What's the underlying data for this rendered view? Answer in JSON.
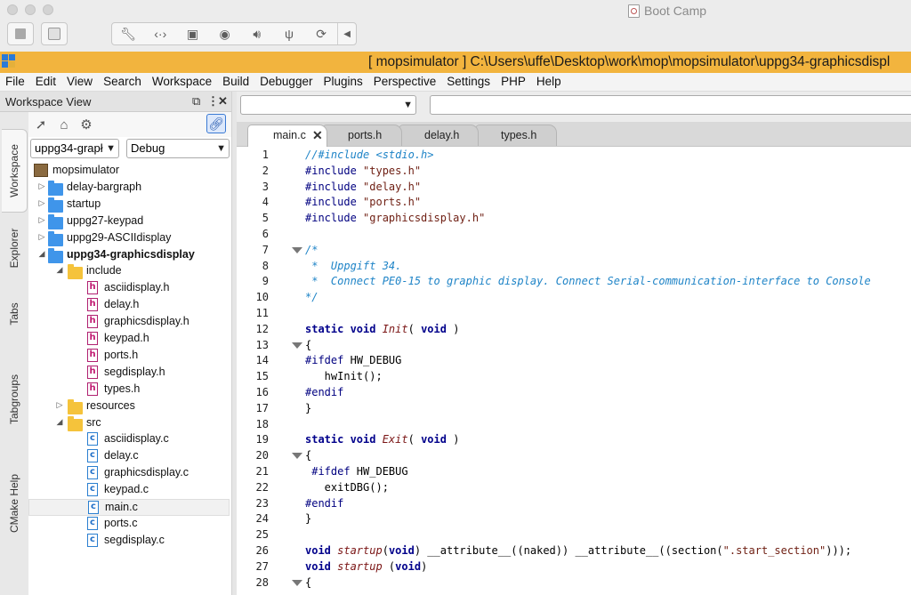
{
  "vm": {
    "title": "Boot Camp",
    "toolbar_icons": [
      "wrench-icon",
      "arrows-icon",
      "hdd-icon",
      "camera-icon",
      "speaker-icon",
      "usb-icon",
      "refresh-icon"
    ]
  },
  "window": {
    "title": "[ mopsimulator ] C:\\Users\\uffe\\Desktop\\work\\mop\\mopsimulator\\uppg34-graphicsdispl"
  },
  "menu": [
    "File",
    "Edit",
    "View",
    "Search",
    "Workspace",
    "Build",
    "Debugger",
    "Plugins",
    "Perspective",
    "Settings",
    "PHP",
    "Help"
  ],
  "side_tabs": [
    "Workspace",
    "Explorer",
    "Tabs",
    "Tabgroups",
    "CMake Help"
  ],
  "workspace": {
    "title": "Workspace View",
    "project_select": "uppg34-grapł",
    "config_select": "Debug",
    "tree": [
      {
        "level": 0,
        "type": "project",
        "label": "mopsimulator",
        "twisty": ""
      },
      {
        "level": 1,
        "type": "folder-blue",
        "label": "delay-bargraph",
        "twisty": "▷"
      },
      {
        "level": 1,
        "type": "folder-blue",
        "label": "startup",
        "twisty": "▷"
      },
      {
        "level": 1,
        "type": "folder-blue",
        "label": "uppg27-keypad",
        "twisty": "▷"
      },
      {
        "level": 1,
        "type": "folder-blue",
        "label": "uppg29-ASCIIdisplay",
        "twisty": "▷"
      },
      {
        "level": 1,
        "type": "folder-blue",
        "label": "uppg34-graphicsdisplay",
        "twisty": "◢",
        "bold": true
      },
      {
        "level": 2,
        "type": "folder-yellow",
        "label": "include",
        "twisty": "◢"
      },
      {
        "level": 3,
        "type": "file-h",
        "label": "asciidisplay.h",
        "twisty": ""
      },
      {
        "level": 3,
        "type": "file-h",
        "label": "delay.h",
        "twisty": ""
      },
      {
        "level": 3,
        "type": "file-h",
        "label": "graphicsdisplay.h",
        "twisty": ""
      },
      {
        "level": 3,
        "type": "file-h",
        "label": "keypad.h",
        "twisty": ""
      },
      {
        "level": 3,
        "type": "file-h",
        "label": "ports.h",
        "twisty": ""
      },
      {
        "level": 3,
        "type": "file-h",
        "label": "segdisplay.h",
        "twisty": ""
      },
      {
        "level": 3,
        "type": "file-h",
        "label": "types.h",
        "twisty": ""
      },
      {
        "level": 2,
        "type": "folder-yellow",
        "label": "resources",
        "twisty": "▷"
      },
      {
        "level": 2,
        "type": "folder-yellow",
        "label": "src",
        "twisty": "◢"
      },
      {
        "level": 3,
        "type": "file-c",
        "label": "asciidisplay.c",
        "twisty": ""
      },
      {
        "level": 3,
        "type": "file-c",
        "label": "delay.c",
        "twisty": ""
      },
      {
        "level": 3,
        "type": "file-c",
        "label": "graphicsdisplay.c",
        "twisty": ""
      },
      {
        "level": 3,
        "type": "file-c",
        "label": "keypad.c",
        "twisty": ""
      },
      {
        "level": 3,
        "type": "file-c",
        "label": "main.c",
        "twisty": "",
        "selected": true
      },
      {
        "level": 3,
        "type": "file-c",
        "label": "ports.c",
        "twisty": ""
      },
      {
        "level": 3,
        "type": "file-c",
        "label": "segdisplay.c",
        "twisty": ""
      }
    ]
  },
  "editor": {
    "tabs": [
      {
        "label": "main.c",
        "active": true,
        "close": "✕"
      },
      {
        "label": "ports.h",
        "active": false
      },
      {
        "label": "delay.h",
        "active": false
      },
      {
        "label": "types.h",
        "active": false
      }
    ],
    "fold_lines": [
      7,
      13,
      20,
      28
    ],
    "lines": [
      [
        [
          "cmt",
          "//#include <stdio.h>"
        ]
      ],
      [
        [
          "pp",
          "#include "
        ],
        [
          "str",
          "\"types.h\""
        ]
      ],
      [
        [
          "pp",
          "#include "
        ],
        [
          "str",
          "\"delay.h\""
        ]
      ],
      [
        [
          "pp",
          "#include "
        ],
        [
          "str",
          "\"ports.h\""
        ]
      ],
      [
        [
          "pp",
          "#include "
        ],
        [
          "str",
          "\"graphicsdisplay.h\""
        ]
      ],
      [],
      [
        [
          "cmt",
          "/*"
        ]
      ],
      [
        [
          "cmt",
          " *  Uppgift 34."
        ]
      ],
      [
        [
          "cmt",
          " *  Connect PE0-15 to graphic display. Connect Serial-communication-interface to Console"
        ]
      ],
      [
        [
          "cmt",
          "*/"
        ]
      ],
      [],
      [
        [
          "kw",
          "static void "
        ],
        [
          "fn",
          "Init"
        ],
        [
          "plain",
          "( "
        ],
        [
          "kw",
          "void"
        ],
        [
          "plain",
          " )"
        ]
      ],
      [
        [
          "plain",
          "{"
        ]
      ],
      [
        [
          "pp",
          "#ifdef "
        ],
        [
          "plain",
          "HW_DEBUG"
        ]
      ],
      [
        [
          "plain",
          "   hwInit();"
        ]
      ],
      [
        [
          "pp",
          "#endif"
        ]
      ],
      [
        [
          "plain",
          "}"
        ]
      ],
      [],
      [
        [
          "kw",
          "static void "
        ],
        [
          "fn",
          "Exit"
        ],
        [
          "plain",
          "( "
        ],
        [
          "kw",
          "void"
        ],
        [
          "plain",
          " )"
        ]
      ],
      [
        [
          "plain",
          "{"
        ]
      ],
      [
        [
          "pp",
          " #ifdef "
        ],
        [
          "plain",
          "HW_DEBUG"
        ]
      ],
      [
        [
          "plain",
          "   exitDBG();"
        ]
      ],
      [
        [
          "pp",
          "#endif"
        ]
      ],
      [
        [
          "plain",
          "}"
        ]
      ],
      [],
      [
        [
          "kw",
          "void "
        ],
        [
          "fn",
          "startup"
        ],
        [
          "plain",
          "("
        ],
        [
          "kw",
          "void"
        ],
        [
          "plain",
          ") __attribute__((naked)) __attribute__((section("
        ],
        [
          "str",
          "\".start_section\""
        ],
        [
          "plain",
          ")));"
        ]
      ],
      [
        [
          "kw",
          "void "
        ],
        [
          "fn",
          "startup"
        ],
        [
          "plain",
          " ("
        ],
        [
          "kw",
          "void"
        ],
        [
          "plain",
          ")"
        ]
      ],
      [
        [
          "plain",
          "{"
        ]
      ]
    ]
  }
}
